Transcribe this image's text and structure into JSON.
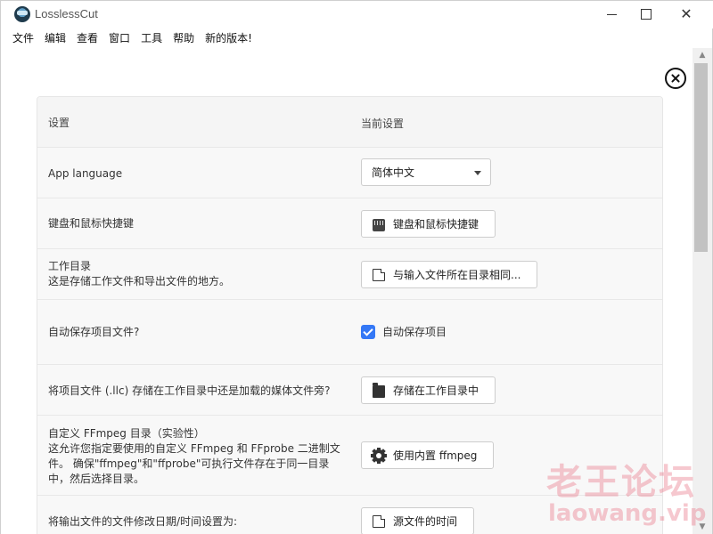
{
  "window": {
    "title": "LosslessCut",
    "icons": {
      "app": "losslesscut-app-icon",
      "minimize": "minimize-icon",
      "maximize": "maximize-icon",
      "close": "close-icon"
    }
  },
  "menu": [
    "文件",
    "编辑",
    "查看",
    "窗口",
    "工具",
    "帮助",
    "新的版本!"
  ],
  "settings": {
    "header": {
      "setting": "设置",
      "current": "当前设置"
    },
    "rows": {
      "language": {
        "label": "App language",
        "value": "简体中文"
      },
      "shortcuts": {
        "label": "键盘和鼠标快捷键",
        "button": "键盘和鼠标快捷键",
        "icon": "keyboard-icon"
      },
      "workdir": {
        "label": "工作目录",
        "description": "这是存储工作文件和导出文件的地方。",
        "button": "与输入文件所在目录相同...",
        "icon": "file-icon"
      },
      "autosave": {
        "label": "自动保存项目文件?",
        "checkbox": "自动保存项目",
        "checked": true
      },
      "project_location": {
        "label": "将项目文件 (.llc) 存储在工作目录中还是加载的媒体文件旁?",
        "button": "存储在工作目录中",
        "icon": "folder-icon"
      },
      "ffmpeg": {
        "label": "自定义 FFmpeg 目录（实验性）",
        "description_1": "这允许您指定要使用的自定义 FFmpeg 和 FFprobe 二进制文",
        "description_2": "件。 确保\"ffmpeg\"和\"ffprobe\"可执行文件存在于同一目录",
        "description_3": "中，然后选择目录。",
        "button": "使用内置 ffmpeg",
        "icon": "gear-icon"
      },
      "mtime": {
        "label": "将输出文件的文件修改日期/时间设置为:",
        "button": "源文件的时间",
        "icon": "file-icon"
      }
    }
  },
  "watermark": {
    "cn": "老王论坛",
    "en": "laowang.vip"
  },
  "colors": {
    "accent": "#3478f6",
    "watermark": "#e86e82"
  }
}
